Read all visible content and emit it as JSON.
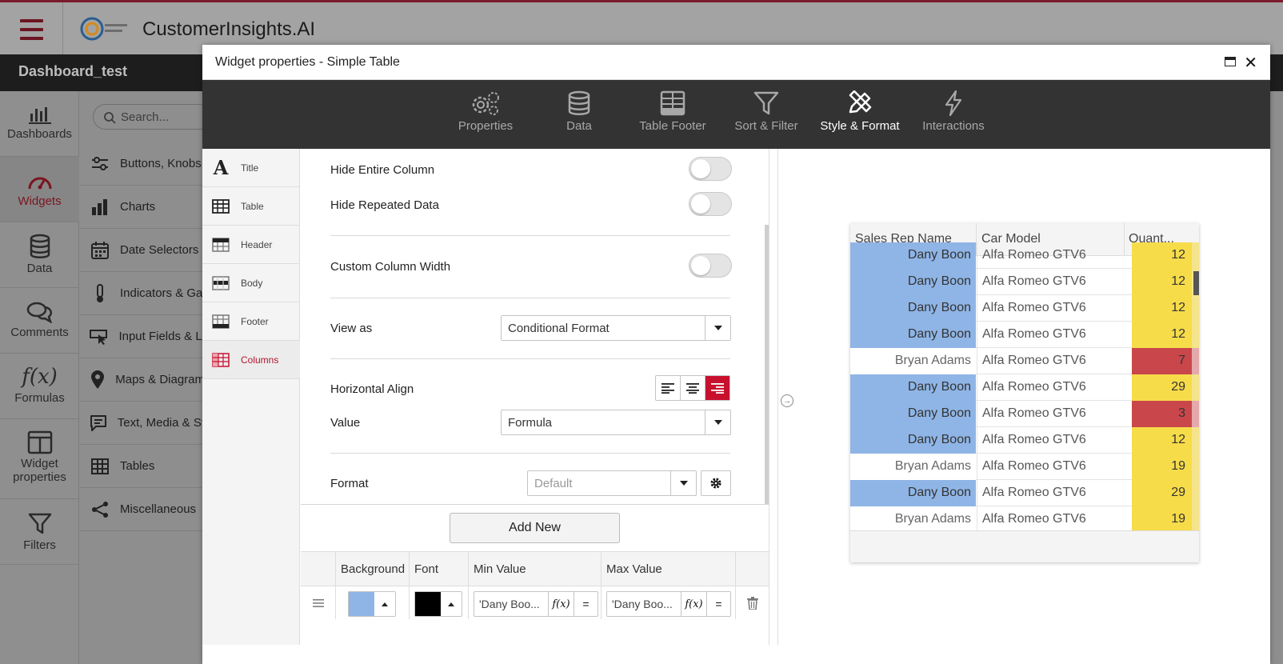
{
  "app": {
    "title": "CustomerInsights.AI",
    "dashboard_name": "Dashboard_test"
  },
  "sidenav": [
    {
      "label": "Dashboards",
      "icon": "bar-chart-icon",
      "active": false
    },
    {
      "label": "Widgets",
      "icon": "gauge-icon",
      "active": true
    },
    {
      "label": "Data",
      "icon": "database-icon",
      "active": false
    },
    {
      "label": "Comments",
      "icon": "comments-icon",
      "active": false
    },
    {
      "label": "Formulas",
      "icon": "formula-icon",
      "active": false
    },
    {
      "label": "Widget properties",
      "icon": "panel-icon",
      "active": false
    },
    {
      "label": "Filters",
      "icon": "filter-icon",
      "active": false
    }
  ],
  "widget_catalog": {
    "search_placeholder": "Search...",
    "categories": [
      "Buttons, Knobs",
      "Charts",
      "Date Selectors",
      "Indicators & Ga",
      "Input Fields & Li",
      "Maps & Diagram",
      "Text, Media & St",
      "Tables",
      "Miscellaneous"
    ]
  },
  "modal": {
    "title": "Widget properties - Simple Table",
    "tabs": [
      "Properties",
      "Data",
      "Table Footer",
      "Sort & Filter",
      "Style & Format",
      "Interactions"
    ],
    "active_tab": "Style & Format",
    "subnav": [
      "Title",
      "Table",
      "Header",
      "Body",
      "Footer",
      "Columns"
    ],
    "active_subnav": "Columns"
  },
  "column_settings": {
    "hide_entire_column": {
      "label": "Hide Entire Column",
      "on": false
    },
    "hide_repeated_data": {
      "label": "Hide Repeated Data",
      "on": false
    },
    "custom_column_width": {
      "label": "Custom Column Width",
      "on": false
    },
    "view_as": {
      "label": "View as",
      "value": "Conditional Format"
    },
    "horizontal_align": {
      "label": "Horizontal Align",
      "value": "right"
    },
    "value": {
      "label": "Value",
      "value": "Formula"
    },
    "format": {
      "label": "Format",
      "placeholder": "Default"
    },
    "add_new_label": "Add New"
  },
  "conditional_format": {
    "headers": [
      "Background",
      "Font",
      "Min Value",
      "Max Value"
    ],
    "rows": [
      {
        "background": "#8fb5e6",
        "font": "#000000",
        "min": "'Dany Boo...",
        "max": "'Dany Boo..."
      }
    ],
    "fx_label": "f(x)",
    "eq_label": "="
  },
  "preview_table": {
    "headers": [
      "Sales Rep Name",
      "Car Model",
      "Quant..."
    ],
    "rows": [
      {
        "rep": "Dany Boon",
        "model": "Alfa Romeo GTV6",
        "qty": "12",
        "rep_bg": "#8fb5e6",
        "qty_bg": "#f7dc4a"
      },
      {
        "rep": "Dany Boon",
        "model": "Alfa Romeo GTV6",
        "qty": "12",
        "rep_bg": "#8fb5e6",
        "qty_bg": "#f7dc4a"
      },
      {
        "rep": "Dany Boon",
        "model": "Alfa Romeo GTV6",
        "qty": "12",
        "rep_bg": "#8fb5e6",
        "qty_bg": "#f7dc4a"
      },
      {
        "rep": "Dany Boon",
        "model": "Alfa Romeo GTV6",
        "qty": "12",
        "rep_bg": "#8fb5e6",
        "qty_bg": "#f7dc4a"
      },
      {
        "rep": "Bryan Adams",
        "model": "Alfa Romeo GTV6",
        "qty": "7",
        "rep_bg": "#ffffff",
        "qty_bg": "#c9474b"
      },
      {
        "rep": "Dany Boon",
        "model": "Alfa Romeo GTV6",
        "qty": "29",
        "rep_bg": "#8fb5e6",
        "qty_bg": "#f7dc4a"
      },
      {
        "rep": "Dany Boon",
        "model": "Alfa Romeo GTV6",
        "qty": "3",
        "rep_bg": "#8fb5e6",
        "qty_bg": "#c9474b"
      },
      {
        "rep": "Dany Boon",
        "model": "Alfa Romeo GTV6",
        "qty": "12",
        "rep_bg": "#8fb5e6",
        "qty_bg": "#f7dc4a"
      },
      {
        "rep": "Bryan Adams",
        "model": "Alfa Romeo GTV6",
        "qty": "19",
        "rep_bg": "#ffffff",
        "qty_bg": "#f7dc4a"
      },
      {
        "rep": "Dany Boon",
        "model": "Alfa Romeo GTV6",
        "qty": "29",
        "rep_bg": "#8fb5e6",
        "qty_bg": "#f7dc4a"
      },
      {
        "rep": "Bryan Adams",
        "model": "Alfa Romeo GTV6",
        "qty": "19",
        "rep_bg": "#ffffff",
        "qty_bg": "#f7dc4a"
      }
    ]
  },
  "colors": {
    "brand": "#7a1520",
    "accent": "#c8102e",
    "tabbar": "#333333"
  }
}
